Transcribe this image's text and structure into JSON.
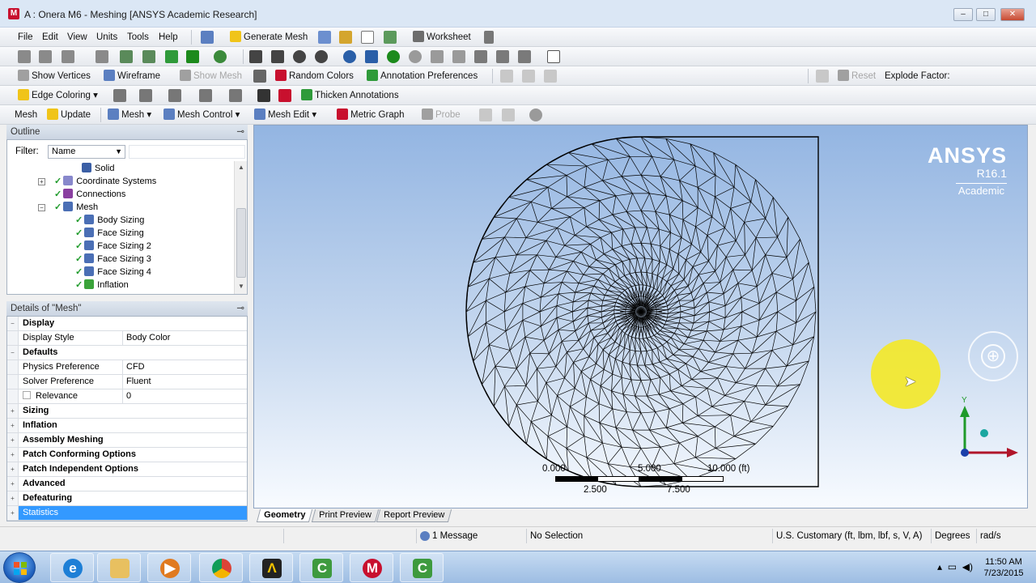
{
  "window": {
    "title": "A : Onera M6 - Meshing [ANSYS Academic Research]",
    "app_icon_letter": "M",
    "controls": {
      "minimize": "–",
      "maximize": "□",
      "close": "✕"
    }
  },
  "menu": {
    "items": [
      "File",
      "Edit",
      "View",
      "Units",
      "Tools",
      "Help"
    ],
    "generate_mesh": "Generate Mesh",
    "worksheet": "Worksheet"
  },
  "toolbar3": {
    "show_vertices": "Show Vertices",
    "wireframe": "Wireframe",
    "show_mesh": "Show Mesh",
    "random_colors": "Random Colors",
    "annotation_preferences": "Annotation Preferences",
    "reset": "Reset",
    "explode_factor": "Explode Factor:"
  },
  "toolbar4": {
    "edge_coloring": "Edge Coloring",
    "thicken_annotations": "Thicken Annotations"
  },
  "toolbar5": {
    "mesh_label": "Mesh",
    "update": "Update",
    "mesh_menu": "Mesh",
    "mesh_control": "Mesh Control",
    "mesh_edit": "Mesh Edit",
    "metric_graph": "Metric Graph",
    "probe": "Probe"
  },
  "outline": {
    "title": "Outline",
    "pin": "ᵩ",
    "filter_label": "Filter:",
    "filter_value": "Name",
    "items": [
      {
        "label": "Solid"
      },
      {
        "label": "Coordinate Systems"
      },
      {
        "label": "Connections"
      },
      {
        "label": "Mesh"
      },
      {
        "label": "Body Sizing"
      },
      {
        "label": "Face Sizing"
      },
      {
        "label": "Face Sizing 2"
      },
      {
        "label": "Face Sizing 3"
      },
      {
        "label": "Face Sizing 4"
      },
      {
        "label": "Inflation"
      }
    ]
  },
  "details": {
    "title": "Details of \"Mesh\"",
    "rows": [
      {
        "key": "Display",
        "value": ""
      },
      {
        "key": "Display Style",
        "value": "Body Color"
      },
      {
        "key": "Defaults",
        "value": ""
      },
      {
        "key": "Physics Preference",
        "value": "CFD"
      },
      {
        "key": "Solver Preference",
        "value": "Fluent"
      },
      {
        "key": "Relevance",
        "value": "0"
      },
      {
        "key": "Sizing",
        "value": ""
      },
      {
        "key": "Inflation",
        "value": ""
      },
      {
        "key": "Assembly Meshing",
        "value": ""
      },
      {
        "key": "Patch Conforming Options",
        "value": ""
      },
      {
        "key": "Patch Independent Options",
        "value": ""
      },
      {
        "key": "Advanced",
        "value": ""
      },
      {
        "key": "Defeaturing",
        "value": ""
      },
      {
        "key": "Statistics",
        "value": ""
      }
    ]
  },
  "viewport": {
    "brand": {
      "name": "ANSYS",
      "release": "R16.1",
      "edition": "Academic"
    },
    "scale": {
      "top_labels": [
        "0.000",
        "5.000",
        "10.000 (ft)"
      ],
      "bottom_labels": [
        "2.500",
        "7.500"
      ]
    },
    "triad_y_label": "Y",
    "colors": {
      "bg_top": "#93b5e2",
      "bg_bottom": "#f8fbff",
      "mesh": "#000000"
    }
  },
  "view_tabs": [
    "Geometry",
    "Print Preview",
    "Report Preview"
  ],
  "status": {
    "messages": "1 Message",
    "selection": "No Selection",
    "units": "U.S. Customary (ft, lbm, lbf, s, V, A)",
    "angle": "Degrees",
    "angular_velocity": "rad/s"
  },
  "taskbar": {
    "clock_time": "11:50 AM",
    "clock_date": "7/23/2015"
  }
}
